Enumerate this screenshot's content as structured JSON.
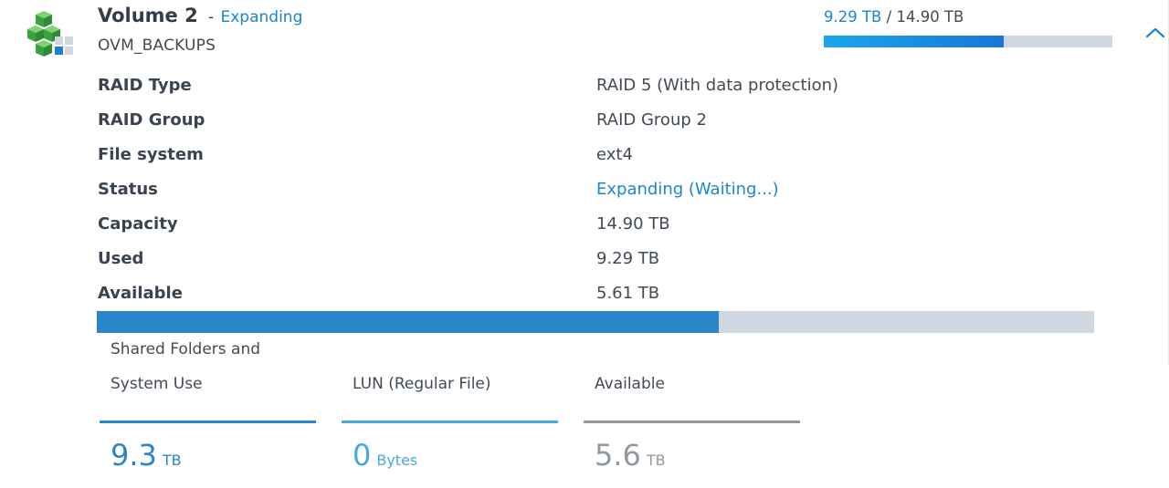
{
  "volume": {
    "name": "Volume 2",
    "separator": "-",
    "state": "Expanding",
    "description": "OVM_BACKUPS",
    "icon": "volume-cubes-icon"
  },
  "summary": {
    "used": "9.29 TB",
    "separator": "/",
    "total": "14.90 TB",
    "used_fraction": 0.6235
  },
  "properties": [
    {
      "label": "RAID Type",
      "value": "RAID 5 (With data protection)"
    },
    {
      "label": "RAID Group",
      "value": "RAID Group 2"
    },
    {
      "label": "File system",
      "value": "ext4"
    },
    {
      "label": "Status",
      "value_link": "Expanding",
      "value_paren": "(Waiting...)"
    },
    {
      "label": "Capacity",
      "value": "14.90 TB"
    },
    {
      "label": "Used",
      "value": "9.29 TB"
    },
    {
      "label": "Available",
      "value": "5.61 TB"
    }
  ],
  "breakdown": [
    {
      "label": "Shared Folders and System Use",
      "value": "9.3",
      "unit": "TB",
      "color": "#2b86c9"
    },
    {
      "label": "LUN (Regular File)",
      "value": "0",
      "unit": "Bytes",
      "color": "#4aa7e0"
    },
    {
      "label": "Available",
      "value": "5.6",
      "unit": "TB",
      "color": "#8f999f"
    }
  ],
  "colors": {
    "accent": "#1b86d0",
    "bar_track": "#cfd8e1",
    "cube_green": "#46b649"
  }
}
